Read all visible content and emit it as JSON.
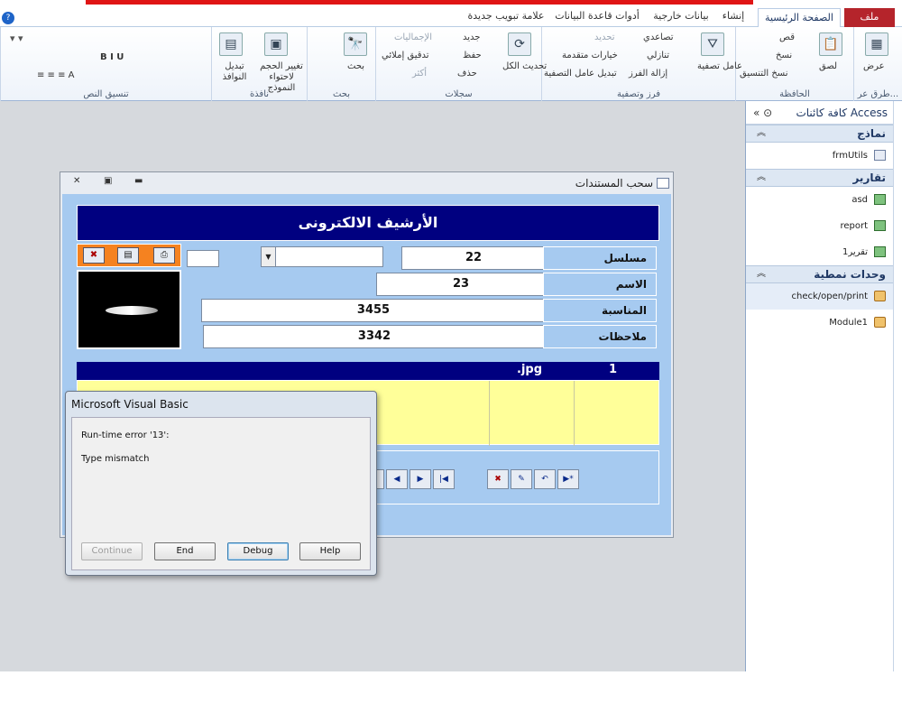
{
  "ribbon_tabs": {
    "file": "ملف",
    "home": "الصفحة الرئيسية",
    "create": "إنشاء",
    "external": "بيانات خارجية",
    "dbtools": "أدوات قاعدة البيانات",
    "newtab": "علامة تبويب جديدة"
  },
  "ribbon": {
    "views": {
      "view": "عرض",
      "label": "طرق عر..."
    },
    "clipboard": {
      "paste": "لصق",
      "cut": "قص",
      "copy": "نسخ",
      "format_painter": "نسخ التنسيق",
      "label": "الحافظة"
    },
    "sort_filter": {
      "filter": "عامل تصفية",
      "ascending": "تصاعدي",
      "descending": "تنازلي",
      "remove_sort": "إزالة الفرز",
      "selection": "تحديد",
      "advanced": "خيارات متقدمة",
      "toggle_filter": "تبديل عامل التصفية",
      "label": "فرز وتصفية"
    },
    "records": {
      "refresh_all": "تحديث الكل",
      "new": "جديد",
      "save": "حفظ",
      "delete": "حذف",
      "totals": "الإجماليات",
      "spelling": "تدقيق إملائي",
      "more": "أكثر",
      "label": "سجلات"
    },
    "find": {
      "find": "بحث",
      "label": "بحث"
    },
    "window": {
      "size_to_fit": "تغيير الحجم لاحتواء النموذج",
      "switch_windows": "تبديل النوافذ",
      "label": "نافذة"
    },
    "text_format": {
      "label": "تنسيق النص"
    }
  },
  "nav_pane": {
    "title": "كافة كائنات Access",
    "sections": [
      {
        "name": "نماذج",
        "items": [
          {
            "label": "frmUtils",
            "type": "form"
          }
        ]
      },
      {
        "name": "تقارير",
        "items": [
          {
            "label": "asd",
            "type": "report"
          },
          {
            "label": "report",
            "type": "report"
          },
          {
            "label": "تقرير1",
            "type": "report"
          }
        ]
      },
      {
        "name": "وحدات نمطية",
        "items": [
          {
            "label": "check/open/print",
            "type": "module"
          },
          {
            "label": "Module1",
            "type": "module"
          }
        ]
      }
    ]
  },
  "form": {
    "window_title": "سحب المستندات",
    "header": "الأرشيف الالكترونى",
    "labels": {
      "serial": "مسلسل",
      "name": "الاسم",
      "occasion": "المناسبة",
      "notes": "ملاحظات"
    },
    "values": {
      "serial": "22",
      "name": "23",
      "occasion": "3455",
      "notes": "3342"
    },
    "subform": {
      "num": "1",
      "ext": ".jpg"
    }
  },
  "dialog": {
    "title": "Microsoft Visual Basic",
    "error_line": "Run-time error '13':",
    "message": "Type mismatch",
    "buttons": {
      "continue": "Continue",
      "end": "End",
      "debug": "Debug",
      "help": "Help"
    }
  },
  "icons": {
    "nav_form": "form-icon",
    "nav_report": "report-icon",
    "nav_module": "module-icon"
  },
  "colors": {
    "form_bg": "#a6caf0",
    "header_bg": "#000080",
    "subgrid_bg": "#ffff99",
    "file_tab": "#b5242b"
  }
}
